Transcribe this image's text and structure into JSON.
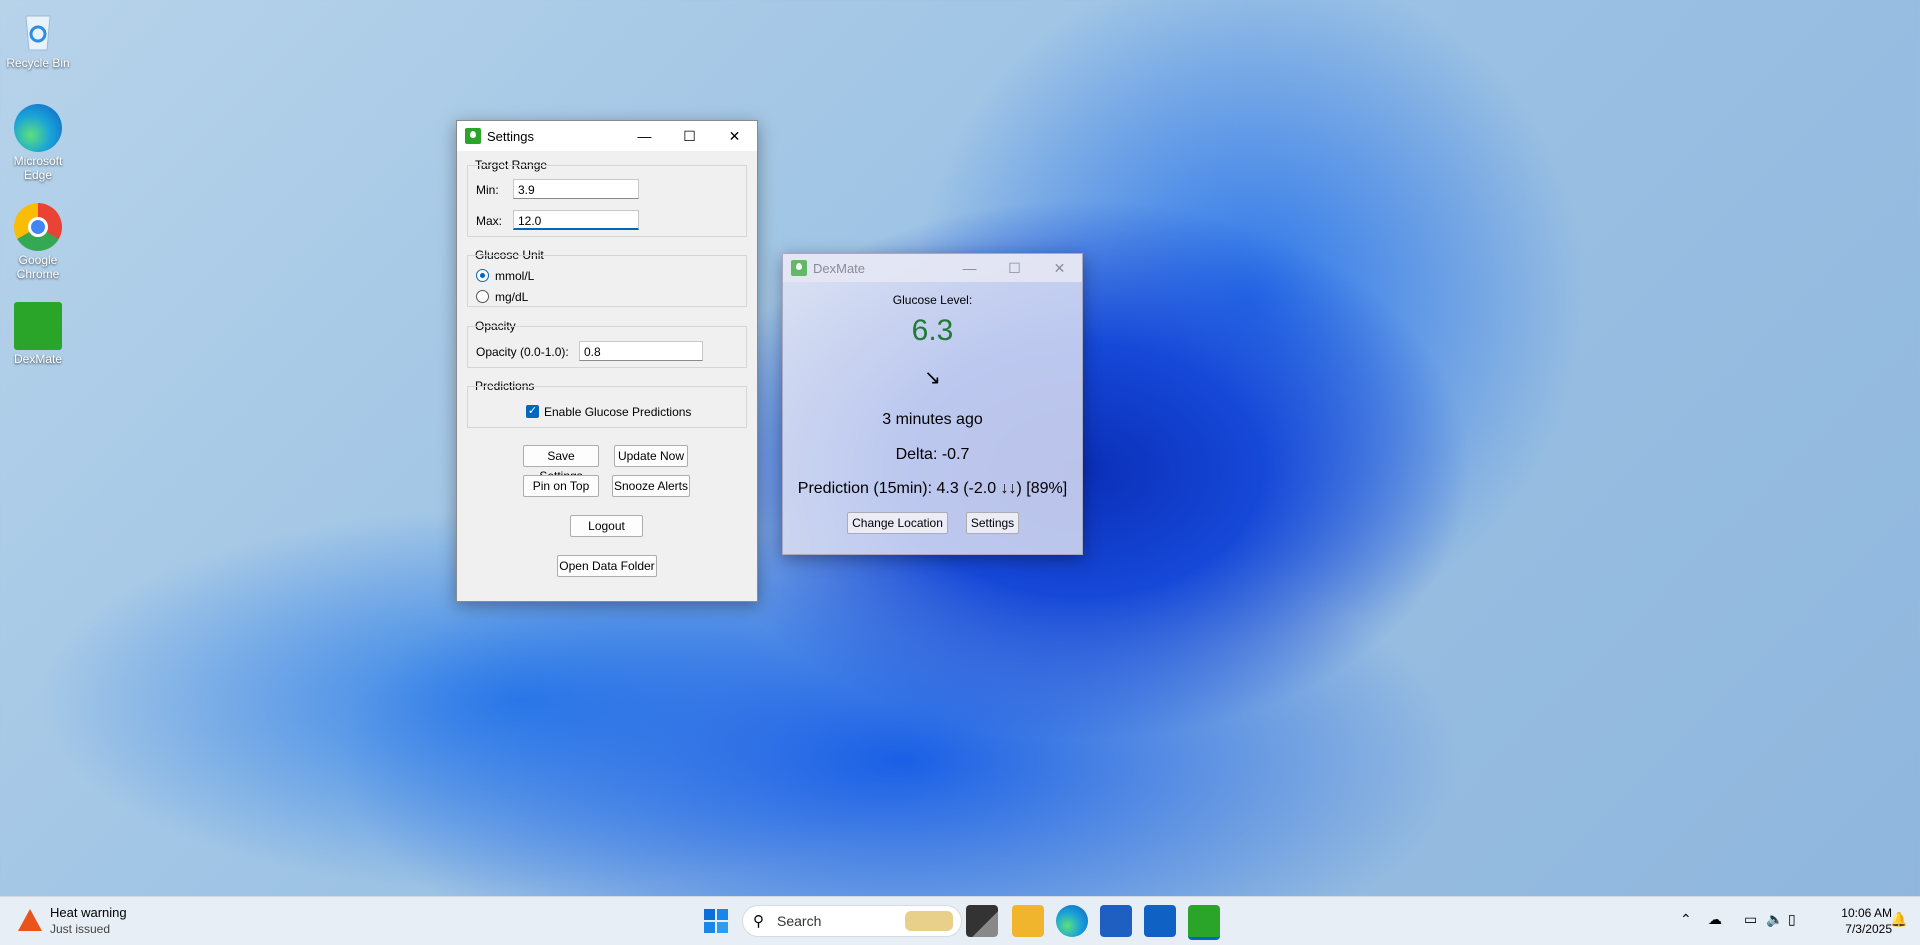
{
  "desktop": {
    "icons": [
      {
        "label": "Recycle Bin"
      },
      {
        "label": "Microsoft Edge"
      },
      {
        "label": "Google Chrome"
      },
      {
        "label": "DexMate"
      }
    ]
  },
  "settings": {
    "title": "Settings",
    "target_range": {
      "legend": "Target Range",
      "min_label": "Min:",
      "min_value": "3.9",
      "max_label": "Max:",
      "max_value": "12.0"
    },
    "glucose_unit": {
      "legend": "Glucose Unit",
      "opt1": "mmol/L",
      "opt2": "mg/dL"
    },
    "opacity": {
      "legend": "Opacity",
      "label": "Opacity (0.0-1.0):",
      "value": "0.8"
    },
    "predictions": {
      "legend": "Predictions",
      "checkbox": "Enable Glucose Predictions"
    },
    "buttons": {
      "save": "Save Settings",
      "update": "Update Now",
      "pin": "Pin on Top",
      "snooze": "Snooze Alerts",
      "logout": "Logout",
      "open_folder": "Open Data Folder"
    }
  },
  "dexmate": {
    "title": "DexMate",
    "glucose_label": "Glucose Level:",
    "glucose_value": "6.3",
    "glucose_color": "#1e7b34",
    "trend_arrow": "↘",
    "time_ago": "3 minutes ago",
    "delta": "Delta: -0.7",
    "prediction": "Prediction (15min): 4.3 (-2.0 ↓↓) [89%]",
    "change_location": "Change Location",
    "settings_button": "Settings"
  },
  "taskbar": {
    "weather_title": "Heat warning",
    "weather_sub": "Just issued",
    "search_placeholder": "Search",
    "time": "10:06 AM",
    "date": "7/3/2025"
  }
}
